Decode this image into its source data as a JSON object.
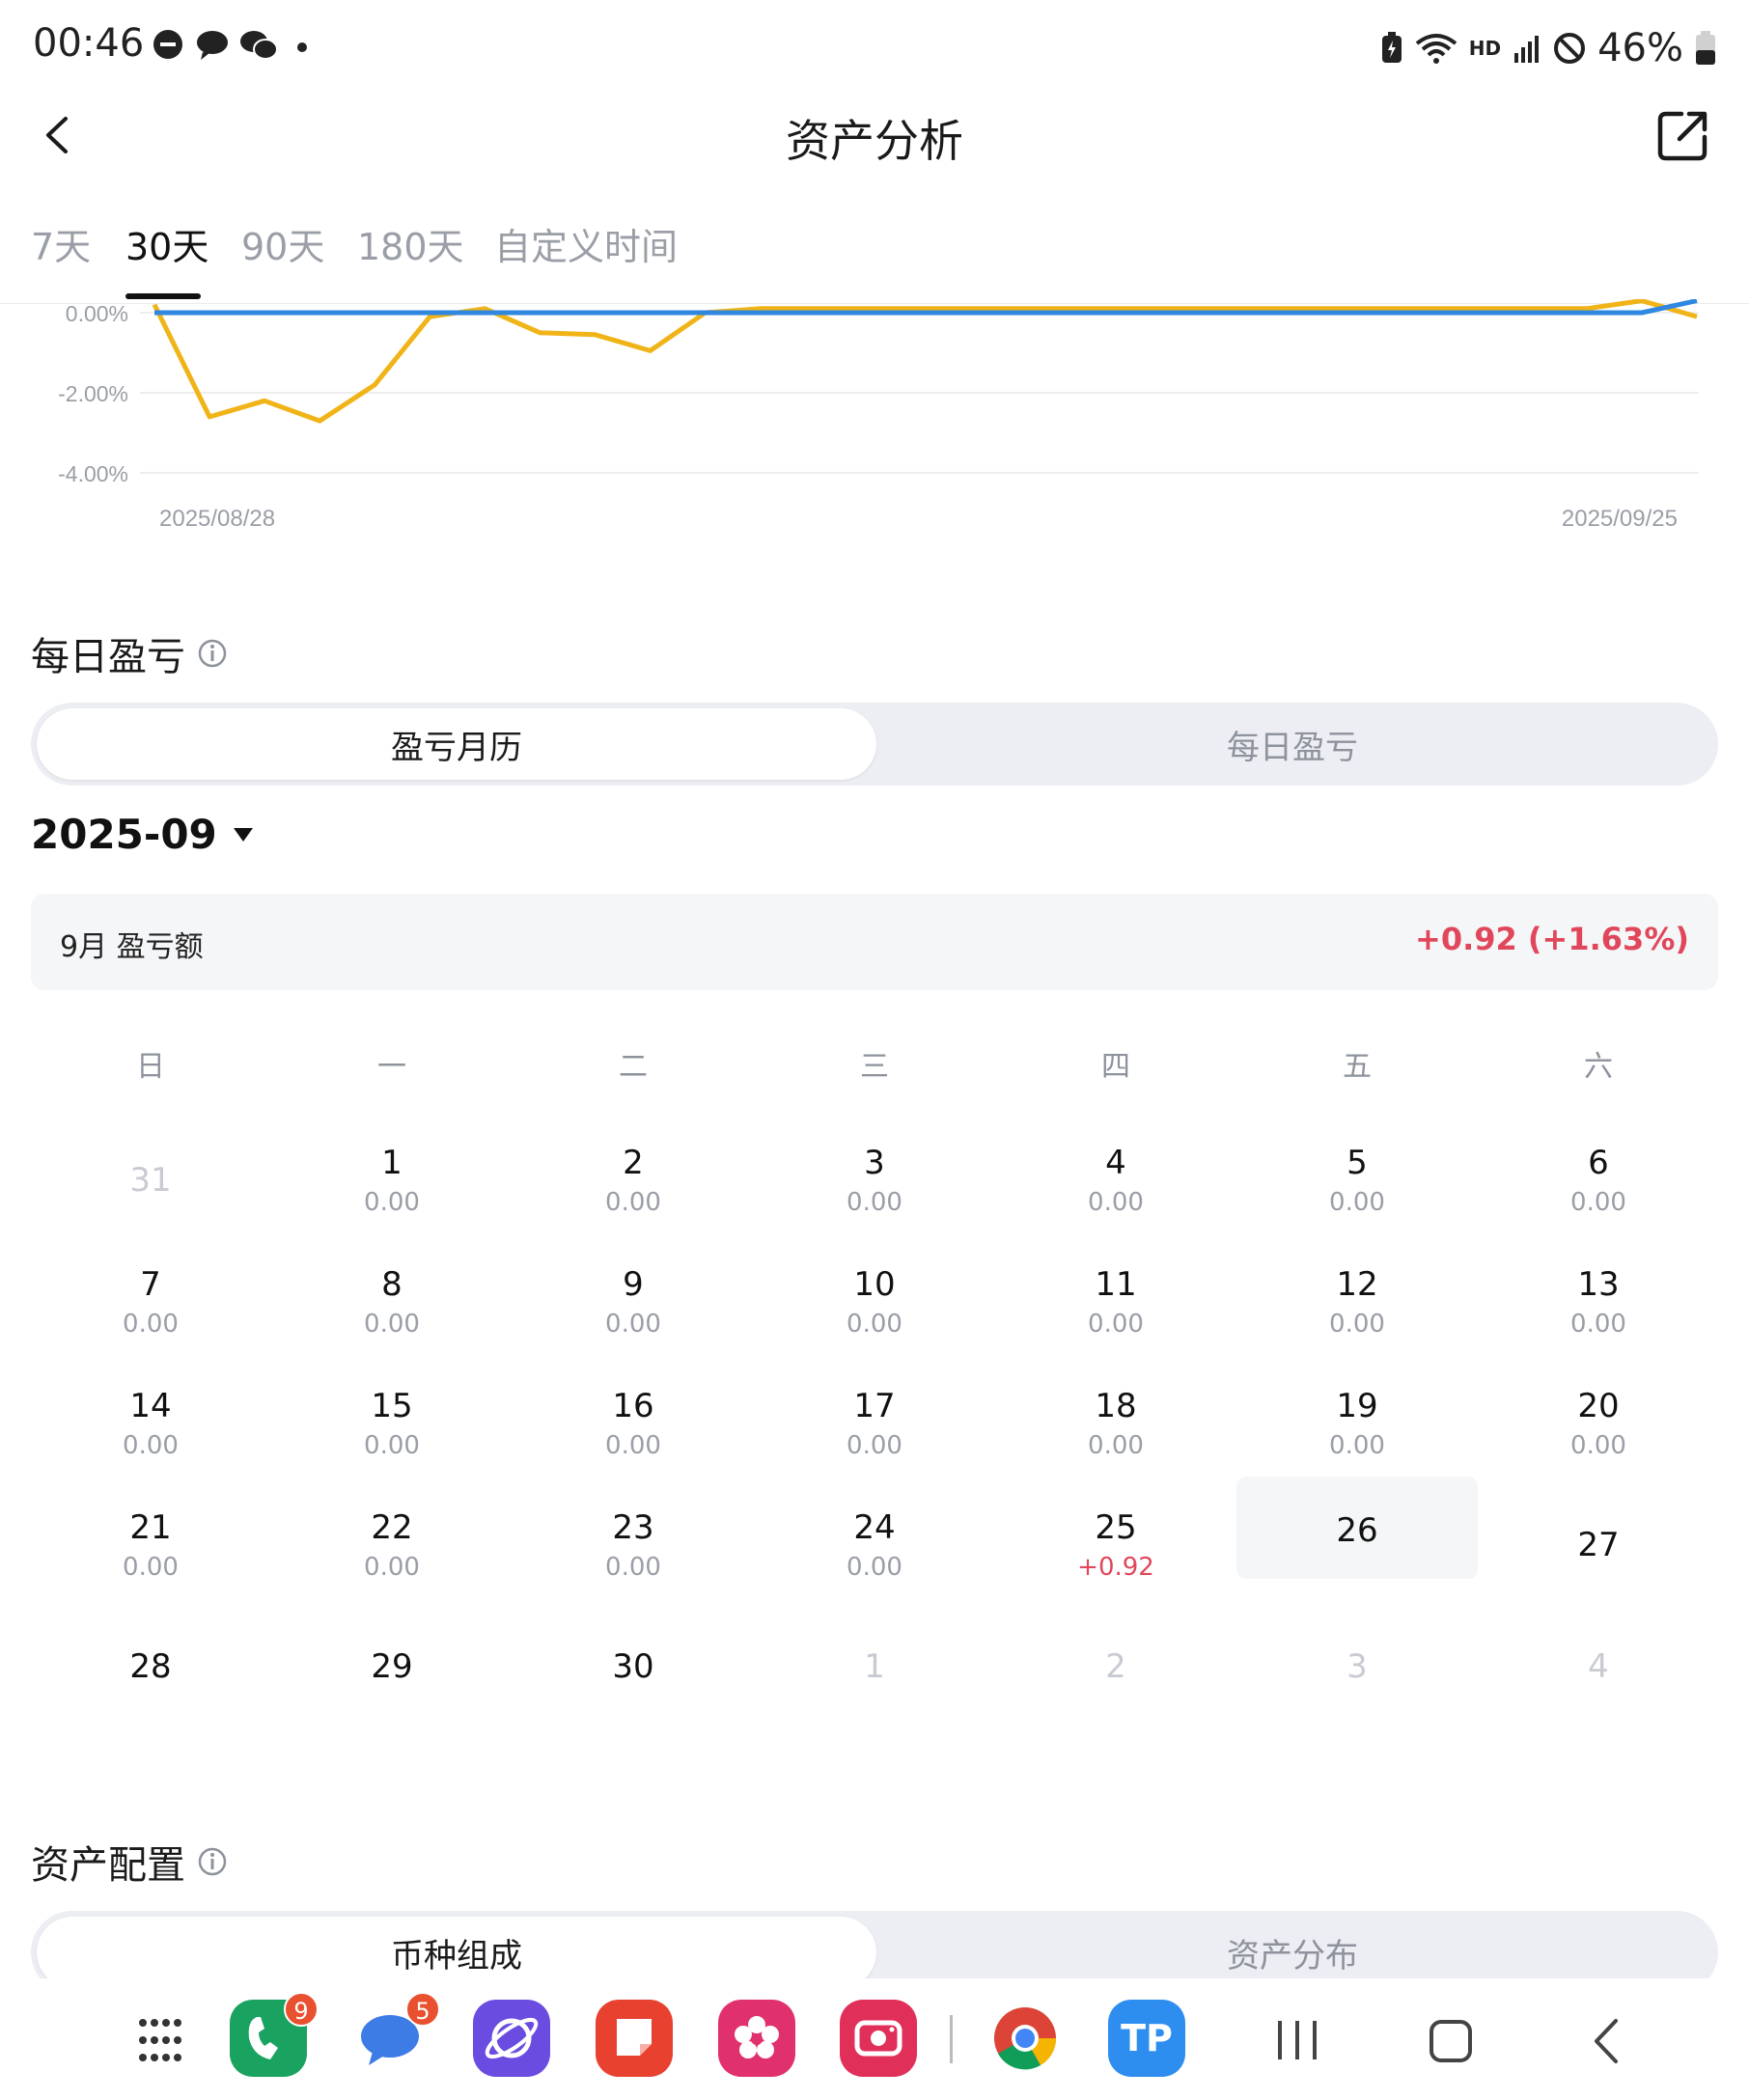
{
  "status_bar": {
    "time": "00:46",
    "battery": "46%",
    "network_label": "HD"
  },
  "header": {
    "title": "资产分析"
  },
  "tabs": [
    {
      "label": "7天",
      "active": false
    },
    {
      "label": "30天",
      "active": true
    },
    {
      "label": "90天",
      "active": false
    },
    {
      "label": "180天",
      "active": false
    },
    {
      "label": "自定义时间",
      "active": false
    }
  ],
  "chart_data": {
    "type": "line",
    "y_ticks": [
      "0.00%",
      "-2.00%",
      "-4.00%"
    ],
    "ylim": [
      -4.0,
      0.0
    ],
    "x_start_label": "2025/08/28",
    "x_end_label": "2025/09/25",
    "series": [
      {
        "color": "#f0b418",
        "values": [
          0.2,
          -2.6,
          -2.2,
          -2.7,
          -1.8,
          -0.1,
          0.1,
          -0.5,
          -0.55,
          -0.95,
          0.0,
          0.1,
          0.1,
          0.1,
          0.1,
          0.1,
          0.1,
          0.1,
          0.1,
          0.1,
          0.1,
          0.1,
          0.1,
          0.1,
          0.1,
          0.1,
          0.1,
          0.3,
          -0.1
        ]
      },
      {
        "color": "#2f87e0",
        "values": [
          0.0,
          0.0,
          0.0,
          0.0,
          0.0,
          0.0,
          0.0,
          0.0,
          0.0,
          0.0,
          0.0,
          0.0,
          0.0,
          0.0,
          0.0,
          0.0,
          0.0,
          0.0,
          0.0,
          0.0,
          0.0,
          0.0,
          0.0,
          0.0,
          0.0,
          0.0,
          0.0,
          0.0,
          0.3
        ]
      }
    ]
  },
  "daily_pnl": {
    "title": "每日盈亏",
    "segments": [
      "盈亏月历",
      "每日盈亏"
    ],
    "month": "2025-09",
    "summary_label": "9月 盈亏额",
    "summary_value": "+0.92 (+1.63%)",
    "weekdays": [
      "日",
      "一",
      "二",
      "三",
      "四",
      "五",
      "六"
    ],
    "days": [
      {
        "d": "31",
        "p": "",
        "muted": true
      },
      {
        "d": "1",
        "p": "0.00"
      },
      {
        "d": "2",
        "p": "0.00"
      },
      {
        "d": "3",
        "p": "0.00"
      },
      {
        "d": "4",
        "p": "0.00"
      },
      {
        "d": "5",
        "p": "0.00"
      },
      {
        "d": "6",
        "p": "0.00"
      },
      {
        "d": "7",
        "p": "0.00"
      },
      {
        "d": "8",
        "p": "0.00"
      },
      {
        "d": "9",
        "p": "0.00"
      },
      {
        "d": "10",
        "p": "0.00"
      },
      {
        "d": "11",
        "p": "0.00"
      },
      {
        "d": "12",
        "p": "0.00"
      },
      {
        "d": "13",
        "p": "0.00"
      },
      {
        "d": "14",
        "p": "0.00"
      },
      {
        "d": "15",
        "p": "0.00"
      },
      {
        "d": "16",
        "p": "0.00"
      },
      {
        "d": "17",
        "p": "0.00"
      },
      {
        "d": "18",
        "p": "0.00"
      },
      {
        "d": "19",
        "p": "0.00"
      },
      {
        "d": "20",
        "p": "0.00"
      },
      {
        "d": "21",
        "p": "0.00"
      },
      {
        "d": "22",
        "p": "0.00"
      },
      {
        "d": "23",
        "p": "0.00"
      },
      {
        "d": "24",
        "p": "0.00"
      },
      {
        "d": "25",
        "p": "+0.92",
        "positive": true
      },
      {
        "d": "26",
        "p": "",
        "today": true
      },
      {
        "d": "27",
        "p": ""
      },
      {
        "d": "28",
        "p": ""
      },
      {
        "d": "29",
        "p": ""
      },
      {
        "d": "30",
        "p": ""
      },
      {
        "d": "1",
        "p": "",
        "muted": true
      },
      {
        "d": "2",
        "p": "",
        "muted": true
      },
      {
        "d": "3",
        "p": "",
        "muted": true
      },
      {
        "d": "4",
        "p": "",
        "muted": true
      }
    ]
  },
  "allocation": {
    "title": "资产配置",
    "segments": [
      "币种组成",
      "资产分布"
    ]
  },
  "navbar": {
    "apps": [
      {
        "icon": "app-drawer-icon"
      },
      {
        "icon": "phone-app-icon",
        "badge": "9",
        "color": "#1aa260"
      },
      {
        "icon": "messages-app-icon",
        "badge": "5",
        "color": "#3d7be5"
      },
      {
        "icon": "internet-app-icon",
        "color": "#6a4ce0"
      },
      {
        "icon": "notes-app-icon",
        "color": "#e8412f"
      },
      {
        "icon": "gallery-app-icon",
        "color": "#e0306e"
      },
      {
        "icon": "camera-app-icon",
        "color": "#e0305a"
      },
      {
        "icon": "chrome-app-icon"
      },
      {
        "icon": "tp-wallet-app-icon",
        "color": "#2e8ef0"
      }
    ],
    "tp_label": "TP"
  }
}
